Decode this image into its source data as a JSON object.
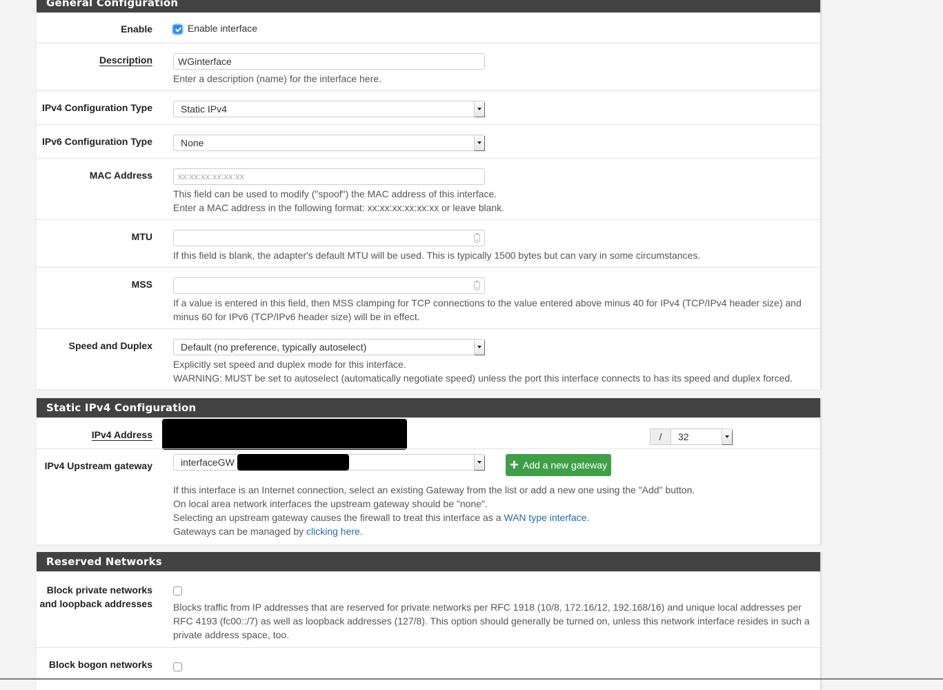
{
  "general": {
    "heading": "General Configuration",
    "enable": {
      "label": "Enable",
      "checkbox_label": "Enable interface",
      "checked": true
    },
    "description": {
      "label": "Description",
      "value": "WGinterface",
      "help": "Enter a description (name) for the interface here."
    },
    "ipv4_type": {
      "label": "IPv4 Configuration Type",
      "value": "Static IPv4"
    },
    "ipv6_type": {
      "label": "IPv6 Configuration Type",
      "value": "None"
    },
    "mac": {
      "label": "MAC Address",
      "placeholder": "xx:xx:xx:xx:xx:xx",
      "help1": "This field can be used to modify (\"spoof\") the MAC address of this interface.",
      "help2": "Enter a MAC address in the following format: xx:xx:xx:xx:xx:xx or leave blank."
    },
    "mtu": {
      "label": "MTU",
      "value": "",
      "help": "If this field is blank, the adapter's default MTU will be used. This is typically 1500 bytes but can vary in some circumstances."
    },
    "mss": {
      "label": "MSS",
      "value": "",
      "help1": "If a value is entered in this field, then MSS clamping for TCP connections to the value entered above minus 40 for IPv4 (TCP/IPv4 header size) and",
      "help2": "minus 60 for IPv6 (TCP/IPv6 header size) will be in effect."
    },
    "speed": {
      "label": "Speed and Duplex",
      "value": "Default (no preference, typically autoselect)",
      "help1": "Explicitly set speed and duplex mode for this interface.",
      "help2": "WARNING: MUST be set to autoselect (automatically negotiate speed) unless the port this interface connects to has its speed and duplex forced."
    }
  },
  "static_ipv4": {
    "heading": "Static IPv4 Configuration",
    "address": {
      "label": "IPv4 Address",
      "separator": "/",
      "cidr": "32"
    },
    "gateway": {
      "label": "IPv4 Upstream gateway",
      "value": "interfaceGW -",
      "add_button": "Add a new gateway",
      "help1": "If this interface is an Internet connection, select an existing Gateway from the list or add a new one using the \"Add\" button.",
      "help2": "On local area network interfaces the upstream gateway should be \"none\".",
      "help3_pre": "Selecting an upstream gateway causes the firewall to treat this interface as a ",
      "help3_link": "WAN type interface",
      "help3_post": ".",
      "help4_pre": "Gateways can be managed by ",
      "help4_link": "clicking here",
      "help4_post": "."
    }
  },
  "reserved": {
    "heading": "Reserved Networks",
    "private": {
      "label1": "Block private networks",
      "label2": "and loopback addresses",
      "checked": false,
      "help1": "Blocks traffic from IP addresses that are reserved for private networks per RFC 1918 (10/8, 172.16/12, 192.168/16) and unique local addresses per",
      "help2": "RFC 4193 (fc00::/7) as well as loopback addresses (127/8). This option should generally be turned on, unless this network interface resides in such a",
      "help3": "private address space, too."
    },
    "bogon": {
      "label": "Block bogon networks",
      "checked": false
    }
  }
}
